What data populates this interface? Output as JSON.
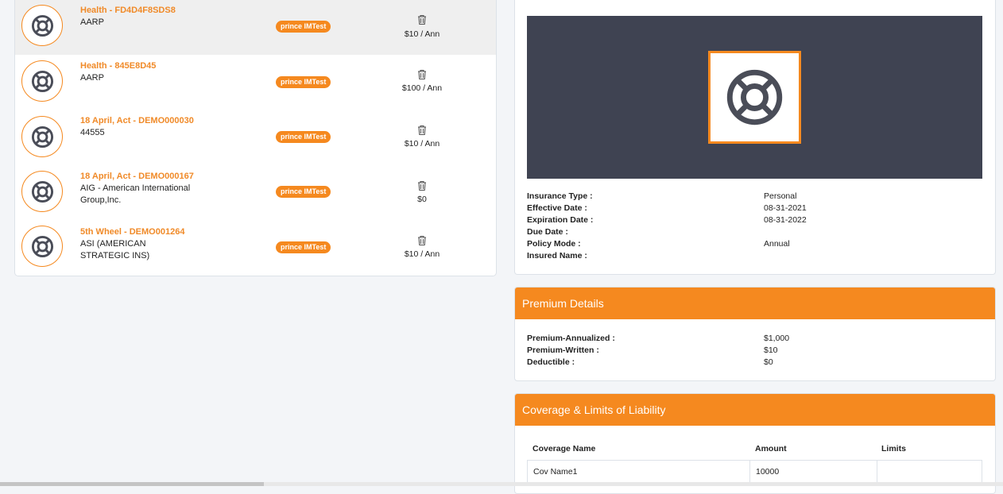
{
  "policies": [
    {
      "title": "Health - FD4D4F8SDS8",
      "sub": [
        "AARP"
      ],
      "badge": "prince IMTest",
      "amount": "$10 / Ann"
    },
    {
      "title": "Health - 845E8D45",
      "sub": [
        "AARP"
      ],
      "badge": "prince IMTest",
      "amount": "$100 / Ann"
    },
    {
      "title": "18 April, Act - DEMO000030",
      "sub": [
        "44555"
      ],
      "badge": "prince IMTest",
      "amount": "$10 / Ann"
    },
    {
      "title": "18 April, Act - DEMO000167",
      "sub": [
        "AIG - American International",
        "Group,Inc."
      ],
      "badge": "prince IMTest",
      "amount": "$0"
    },
    {
      "title": "5th Wheel - DEMO001264",
      "sub": [
        "ASI (AMERICAN",
        "STRATEGIC INS)"
      ],
      "badge": "prince IMTest",
      "amount": "$10 / Ann"
    }
  ],
  "details": {
    "insurance_type_label": "Insurance Type :",
    "insurance_type": "Personal",
    "effective_date_label": "Effective Date :",
    "effective_date": "08-31-2021",
    "expiration_date_label": "Expiration Date :",
    "expiration_date": "08-31-2022",
    "due_date_label": "Due Date :",
    "due_date": "",
    "policy_mode_label": "Policy Mode :",
    "policy_mode": "Annual",
    "insured_name_label": "Insured Name :",
    "insured_name": ""
  },
  "premium": {
    "title": "Premium Details",
    "annualized_label": "Premium-Annualized :",
    "annualized": "$1,000",
    "written_label": "Premium-Written :",
    "written": "$10",
    "deductible_label": "Deductible :",
    "deductible": "$0"
  },
  "coverage": {
    "title": "Coverage & Limits of Liability",
    "col_name": "Coverage Name",
    "col_amount": "Amount",
    "col_limits": "Limits",
    "rows": [
      {
        "name": "Cov Name1",
        "amount": "10000",
        "limits": ""
      }
    ]
  },
  "icons": {
    "row_icon": "life-ring-icon",
    "trash": "trash-icon",
    "banner_icon": "life-ring-icon"
  },
  "colors": {
    "accent": "#f5891f",
    "banner_bg": "#3f4352",
    "title_orange": "#f08a28"
  }
}
